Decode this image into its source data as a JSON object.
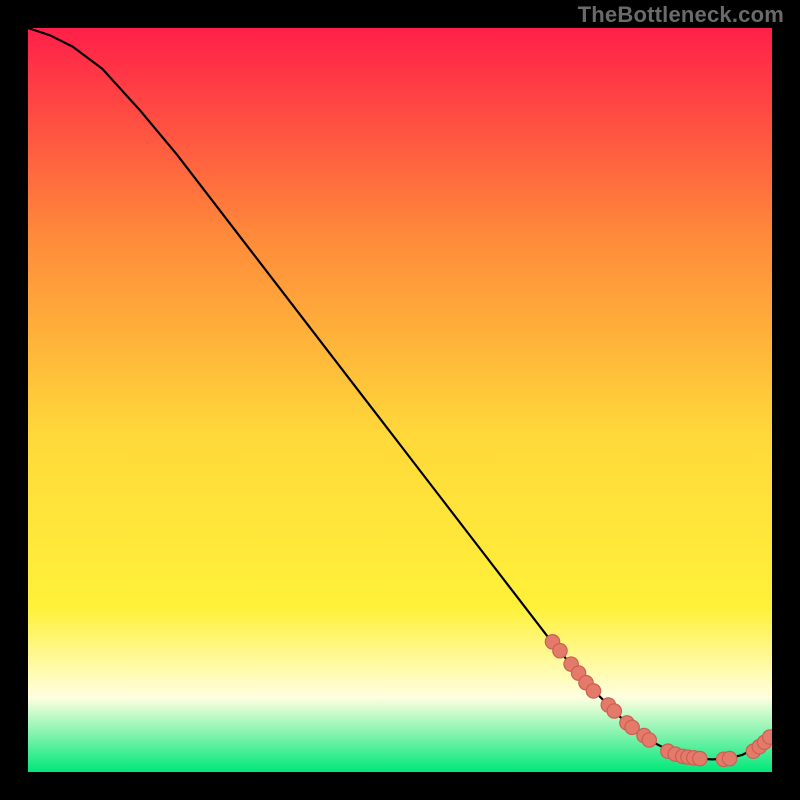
{
  "watermark": "TheBottleneck.com",
  "colors": {
    "background": "#000000",
    "gradient_top": "#ff1f49",
    "gradient_upper_mid": "#ff8a3a",
    "gradient_mid": "#ffd93a",
    "gradient_lower_mid": "#fff13a",
    "gradient_pale": "#ffffe0",
    "gradient_bottom": "#00e77a",
    "curve": "#000000",
    "marker_fill": "#e47a6a",
    "marker_stroke": "#cc5f52",
    "watermark_text": "#6a6a6a"
  },
  "chart_data": {
    "type": "line",
    "title": "",
    "xlabel": "",
    "ylabel": "",
    "xlim": [
      0,
      100
    ],
    "ylim": [
      0,
      100
    ],
    "grid": false,
    "legend": false,
    "series": [
      {
        "name": "curve",
        "x": [
          0,
          3,
          6,
          10,
          15,
          20,
          25,
          30,
          35,
          40,
          45,
          50,
          55,
          60,
          65,
          70,
          75,
          78,
          80,
          82,
          84,
          86,
          88,
          90,
          92,
          94,
          96,
          98,
          100
        ],
        "y": [
          100,
          99,
          97.5,
          94.5,
          89,
          83,
          76.5,
          70,
          63.5,
          57,
          50.5,
          44,
          37.5,
          31,
          24.5,
          18,
          12,
          9,
          7,
          5.5,
          4,
          3,
          2.2,
          1.8,
          1.7,
          1.8,
          2.3,
          3.3,
          5
        ]
      }
    ],
    "markers": [
      {
        "x": 70.5,
        "y": 17.5
      },
      {
        "x": 71.5,
        "y": 16.3
      },
      {
        "x": 73.0,
        "y": 14.5
      },
      {
        "x": 74.0,
        "y": 13.3
      },
      {
        "x": 75.0,
        "y": 12.0
      },
      {
        "x": 76.0,
        "y": 10.9
      },
      {
        "x": 78.0,
        "y": 9.0
      },
      {
        "x": 78.8,
        "y": 8.2
      },
      {
        "x": 80.5,
        "y": 6.6
      },
      {
        "x": 81.2,
        "y": 6.0
      },
      {
        "x": 82.8,
        "y": 4.9
      },
      {
        "x": 83.5,
        "y": 4.3
      },
      {
        "x": 86.0,
        "y": 2.8
      },
      {
        "x": 87.0,
        "y": 2.4
      },
      {
        "x": 88.0,
        "y": 2.1
      },
      {
        "x": 88.7,
        "y": 2.0
      },
      {
        "x": 89.5,
        "y": 1.9
      },
      {
        "x": 90.3,
        "y": 1.8
      },
      {
        "x": 93.5,
        "y": 1.7
      },
      {
        "x": 94.3,
        "y": 1.8
      },
      {
        "x": 97.5,
        "y": 2.8
      },
      {
        "x": 98.3,
        "y": 3.4
      },
      {
        "x": 99.0,
        "y": 4.0
      },
      {
        "x": 99.7,
        "y": 4.7
      }
    ]
  }
}
